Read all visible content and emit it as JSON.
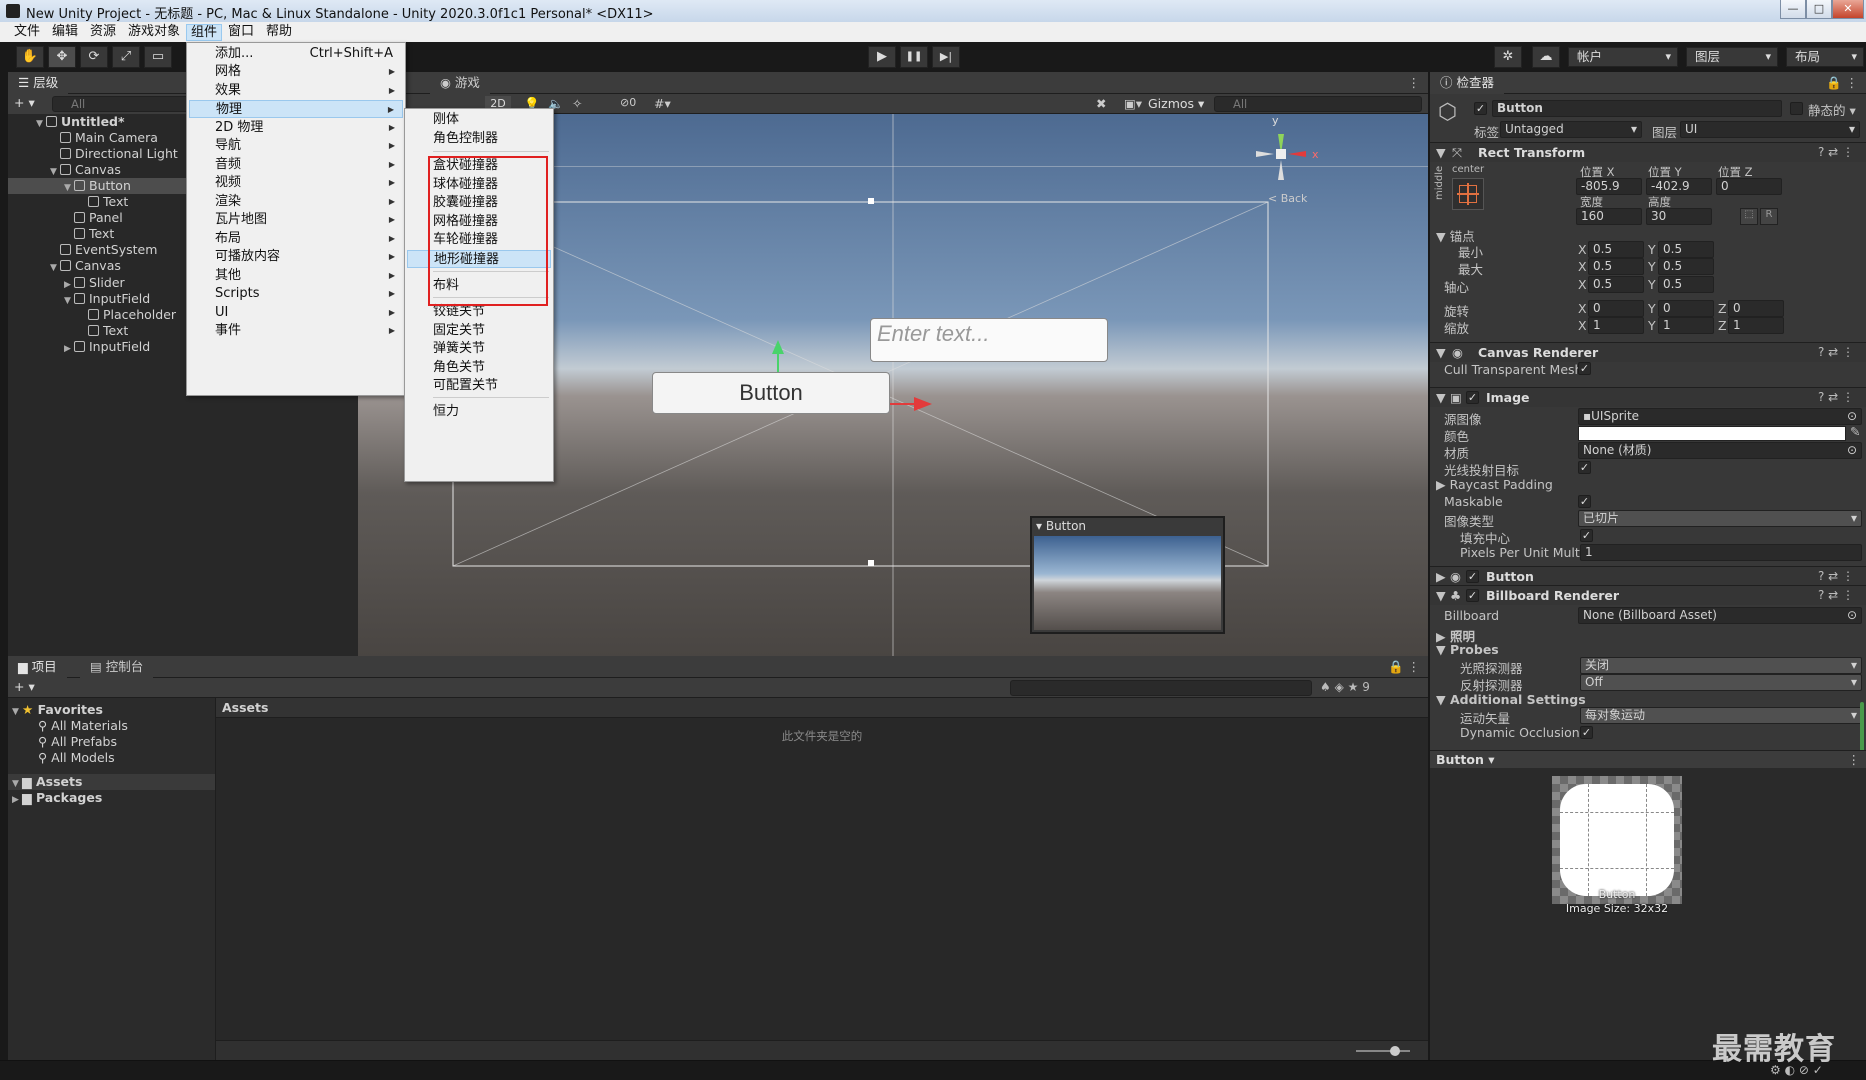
{
  "window": {
    "title": "New Unity Project - 无标题 - PC, Mac & Linux Standalone - Unity 2020.3.0f1c1 Personal* <DX11>",
    "min": "—",
    "max": "□",
    "close": "✕"
  },
  "menubar": [
    "文件",
    "编辑",
    "资源",
    "游戏对象",
    "组件",
    "窗口",
    "帮助"
  ],
  "toolbar": {
    "play": "▶",
    "pause": "❚❚",
    "step": "▶|",
    "account": "帐户",
    "layers": "图层",
    "layout": "布局"
  },
  "hierarchy": {
    "tab": "层级",
    "search_placeholder": "All",
    "add": "+ ▾",
    "rows": [
      {
        "label": "Untitled*",
        "indent": 0,
        "arrow": "▼",
        "icon": "unity-scene-icon",
        "bold": true
      },
      {
        "label": "Main Camera",
        "indent": 1,
        "arrow": "",
        "icon": "gameobject-cube-icon"
      },
      {
        "label": "Directional Light",
        "indent": 1,
        "arrow": "",
        "icon": "gameobject-cube-icon"
      },
      {
        "label": "Canvas",
        "indent": 1,
        "arrow": "▼",
        "icon": "gameobject-cube-icon"
      },
      {
        "label": "Button",
        "indent": 2,
        "arrow": "▼",
        "icon": "gameobject-cube-icon",
        "selected": true
      },
      {
        "label": "Text",
        "indent": 3,
        "arrow": "",
        "icon": "gameobject-cube-icon"
      },
      {
        "label": "Panel",
        "indent": 2,
        "arrow": "",
        "icon": "gameobject-cube-icon"
      },
      {
        "label": "Text",
        "indent": 2,
        "arrow": "",
        "icon": "gameobject-cube-icon"
      },
      {
        "label": "EventSystem",
        "indent": 1,
        "arrow": "",
        "icon": "gameobject-cube-icon"
      },
      {
        "label": "Canvas",
        "indent": 1,
        "arrow": "▼",
        "icon": "gameobject-cube-icon"
      },
      {
        "label": "Slider",
        "indent": 2,
        "arrow": "▶",
        "icon": "gameobject-cube-icon"
      },
      {
        "label": "InputField",
        "indent": 2,
        "arrow": "▼",
        "icon": "gameobject-cube-icon"
      },
      {
        "label": "Placeholder",
        "indent": 3,
        "arrow": "",
        "icon": "gameobject-cube-icon"
      },
      {
        "label": "Text",
        "indent": 3,
        "arrow": "",
        "icon": "gameobject-cube-icon"
      },
      {
        "label": "InputField",
        "indent": 2,
        "arrow": "▶",
        "icon": "gameobject-cube-icon"
      }
    ]
  },
  "component_menu": [
    {
      "label": "添加...",
      "shortcut": "Ctrl+Shift+A",
      "arrow": ""
    },
    {
      "label": "网格",
      "arrow": "▶"
    },
    {
      "label": "效果",
      "arrow": "▶"
    },
    {
      "label": "物理",
      "arrow": "▶",
      "highlight": true
    },
    {
      "label": "2D 物理",
      "arrow": "▶"
    },
    {
      "label": "导航",
      "arrow": "▶"
    },
    {
      "label": "音频",
      "arrow": "▶"
    },
    {
      "label": "视频",
      "arrow": "▶"
    },
    {
      "label": "渲染",
      "arrow": "▶"
    },
    {
      "label": "瓦片地图",
      "arrow": "▶"
    },
    {
      "label": "布局",
      "arrow": "▶"
    },
    {
      "label": "可播放内容",
      "arrow": "▶"
    },
    {
      "label": "其他",
      "arrow": "▶"
    },
    {
      "label": "Scripts",
      "arrow": "▶"
    },
    {
      "label": "UI",
      "arrow": "▶"
    },
    {
      "label": "事件",
      "arrow": "▶"
    }
  ],
  "physics_menu": {
    "group1": [
      "刚体",
      "角色控制器"
    ],
    "colliders": [
      "盒状碰撞器",
      "球体碰撞器",
      "胶囊碰撞器",
      "网格碰撞器",
      "车轮碰撞器",
      "地形碰撞器"
    ],
    "cloth": "布料",
    "joints": [
      "铰链关节",
      "固定关节",
      "弹簧关节",
      "角色关节",
      "可配置关节"
    ],
    "force": "恒力",
    "highlight_border_color": "#e02020"
  },
  "scene": {
    "game_tab": "游戏",
    "mode2d": "2D",
    "gizmos": "Gizmos",
    "search_placeholder": "All",
    "hidden_count": "0",
    "input_placeholder": "Enter text...",
    "button_label": "Button",
    "back_label": "< Back",
    "preview_title": "Button",
    "axis_y": "y",
    "axis_x": "x"
  },
  "project": {
    "tab_project": "项目",
    "tab_console": "控制台",
    "favorites": "Favorites",
    "fav_items": [
      "All Materials",
      "All Prefabs",
      "All Models"
    ],
    "assets": "Assets",
    "packages": "Packages",
    "assets_header": "Assets",
    "empty_message": "此文件夹是空的",
    "hidden_count": "9"
  },
  "inspector": {
    "tab": "检查器",
    "object_name": "Button",
    "static_label": "静态的",
    "tag_label": "标签",
    "tag_value": "Untagged",
    "layer_label": "图层",
    "layer_value": "UI",
    "rect": {
      "title": "Rect Transform",
      "anchor_h": "center",
      "anchor_v": "middle",
      "pos_x_label": "位置 X",
      "pos_y_label": "位置 Y",
      "pos_z_label": "位置 Z",
      "pos_x": "-805.9",
      "pos_y": "-402.9",
      "pos_z": "0",
      "width_label": "宽度",
      "height_label": "高度",
      "width": "160",
      "height": "30",
      "r_button": "R",
      "anchors_label": "锚点",
      "min_label": "最小",
      "max_label": "最大",
      "pivot_label": "轴心",
      "min_x": "0.5",
      "min_y": "0.5",
      "max_x": "0.5",
      "max_y": "0.5",
      "pivot_x": "0.5",
      "pivot_y": "0.5",
      "rotation_label": "旋转",
      "scale_label": "缩放",
      "rot_x": "0",
      "rot_y": "0",
      "rot_z": "0",
      "scale_x": "1",
      "scale_y": "1",
      "scale_z": "1"
    },
    "canvas_renderer": {
      "title": "Canvas Renderer",
      "cull_label": "Cull Transparent Mesh"
    },
    "image": {
      "title": "Image",
      "source_label": "源图像",
      "source_value": "UISprite",
      "color_label": "颜色",
      "material_label": "材质",
      "material_value": "None (材质)",
      "raycast_label": "光线投射目标",
      "raycast_padding": "Raycast Padding",
      "maskable": "Maskable",
      "type_label": "图像类型",
      "type_value": "已切片",
      "fill_center": "填充中心",
      "ppu_label": "Pixels Per Unit Multiplier",
      "ppu_value": "1",
      "color_value": "#ffffff"
    },
    "button": {
      "title": "Button"
    },
    "billboard": {
      "title": "Billboard Renderer",
      "billboard_label": "Billboard",
      "billboard_value": "None (Billboard Asset)",
      "lighting": "照明",
      "probes": "Probes",
      "light_probes_label": "光照探测器",
      "light_probes_value": "关闭",
      "reflection_label": "反射探测器",
      "reflection_value": "Off",
      "additional": "Additional Settings",
      "motion_label": "运动矢量",
      "motion_value": "每对象运动",
      "dynamic_occ": "Dynamic Occlusion"
    },
    "preview": {
      "title": "Button",
      "label": "Button",
      "size": "Image Size: 32x32"
    }
  },
  "watermark": "最需教育",
  "colors": {
    "accent": "#2c5d87",
    "selection": "#2c5d87",
    "menu_bg": "#f0f0f0",
    "panel": "#282828"
  }
}
